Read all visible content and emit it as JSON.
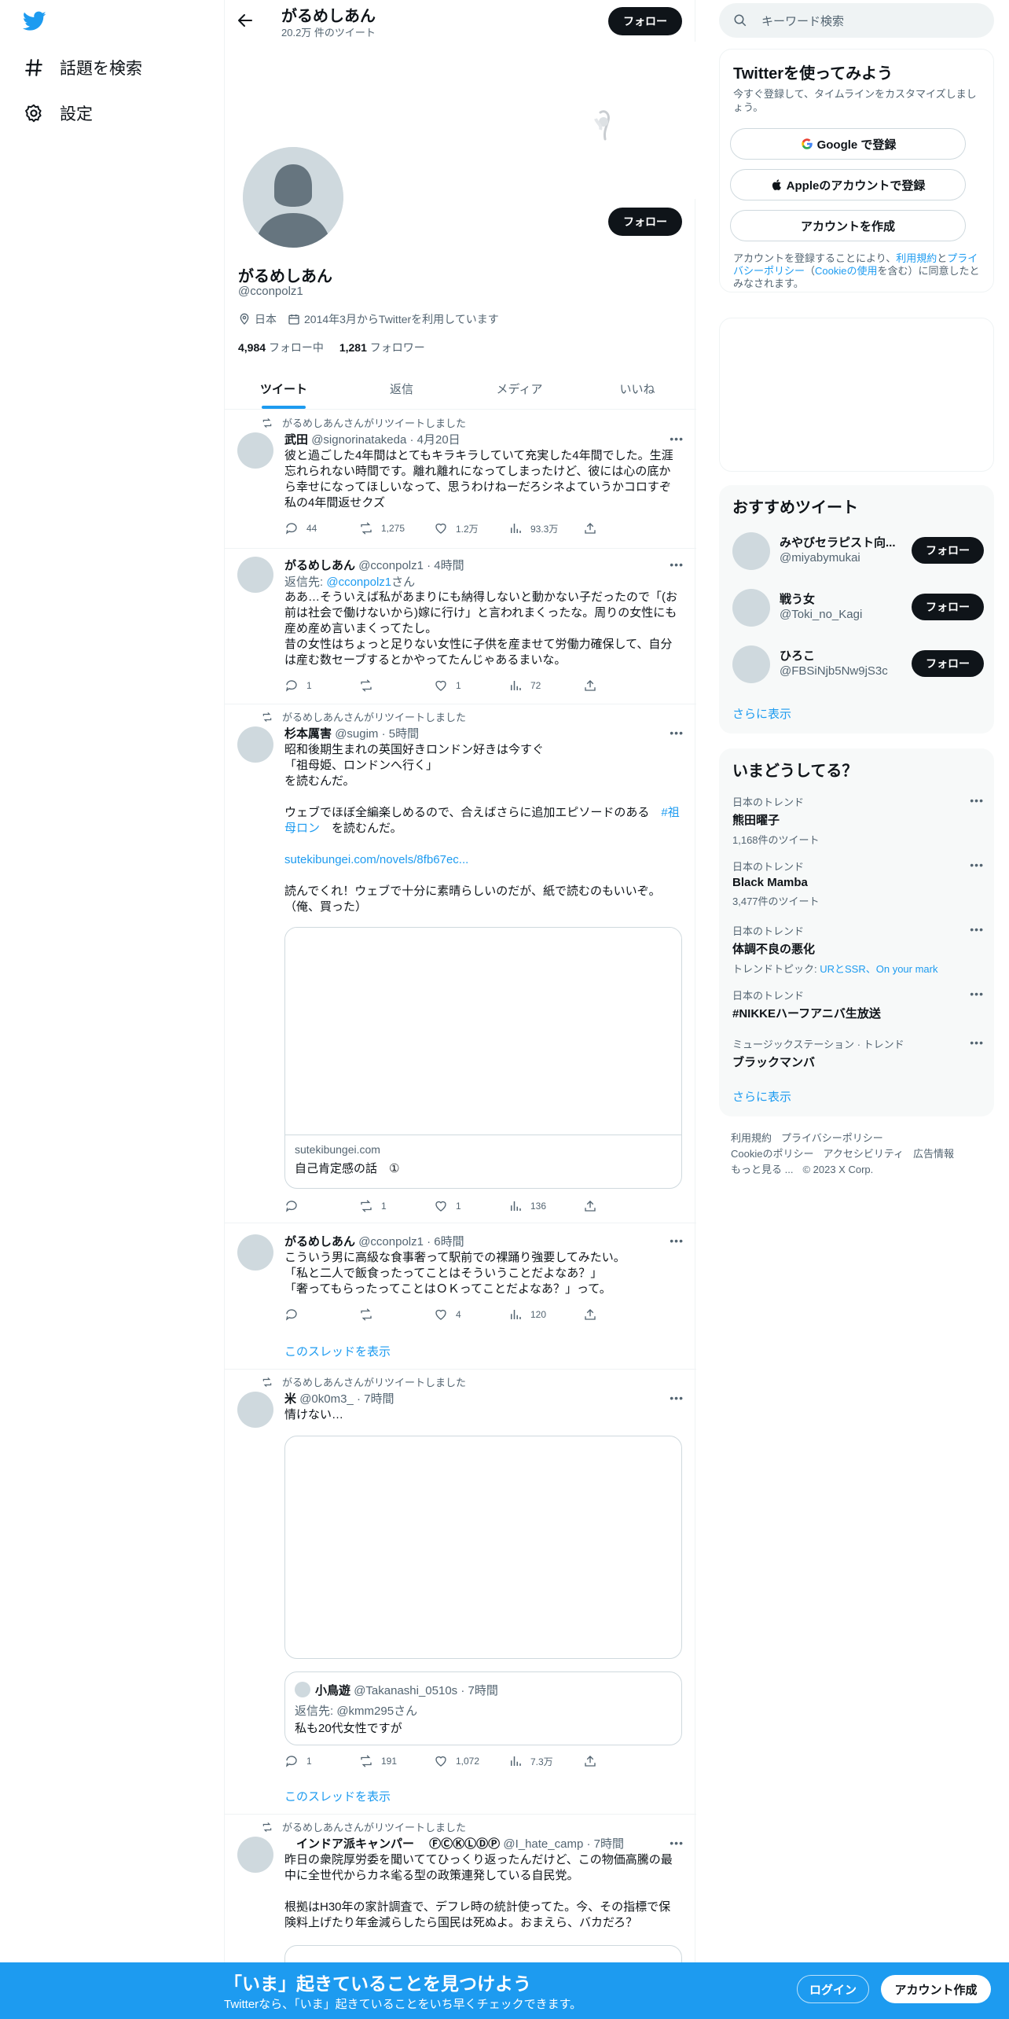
{
  "nav": {
    "items": [
      {
        "label": "話題を検索",
        "icon": "hashtag-icon"
      },
      {
        "label": "設定",
        "icon": "gear-icon"
      }
    ]
  },
  "header": {
    "name": "がるめしあん",
    "tweet_count": "20.2万 件のツイート",
    "follow_label": "フォロー"
  },
  "profile": {
    "name": "がるめしあん",
    "handle": "@cconpolz1",
    "location": "日本",
    "joined": "2014年3月からTwitterを利用しています",
    "following_count": "4,984",
    "following_label": "フォロー中",
    "followers_count": "1,281",
    "followers_label": "フォロワー",
    "follow_label": "フォロー"
  },
  "tabs": [
    "ツイート",
    "返信",
    "メディア",
    "いいね"
  ],
  "tweets": [
    {
      "retweet_label": "がるめしあんさんがリツイートしました",
      "name": "武田",
      "meta": "@signorinatakeda · 4月20日",
      "body": "彼と過ごした4年間はとてもキラキラしていて充実した4年間でした。生涯忘れられない時間です。離れ離れになってしまったけど、彼には心の底から幸せになってほしいなって、思うわけねーだろシネよていうかコロすぞ私の4年間返せクズ",
      "replies": "44",
      "retweets": "1,275",
      "likes": "1.2万",
      "views": "93.3万"
    },
    {
      "name": "がるめしあん",
      "meta": "@cconpolz1 · 4時間",
      "reply_prefix": "返信先: ",
      "reply_to": "@cconpolz1",
      "reply_suffix": "さん",
      "body": "ああ…そういえば私があまりにも納得しないと動かない子だったので「(お前は社会で働けないから)嫁に行け」と言われまくったな。周りの女性にも産め産め言いまくってたし。\n昔の女性はちょっと足りない女性に子供を産ませて労働力確保して、自分は産む数セーブするとかやってたんじゃあるまいな。",
      "replies": "1",
      "retweets": "",
      "likes": "1",
      "views": "72"
    },
    {
      "retweet_label": "がるめしあんさんがリツイートしました",
      "name": "杉本厲害",
      "meta": "@sugim · 5時間",
      "body_1": "昭和後期生まれの英国好きロンドン好きは今すぐ\n「祖母姫、ロンドンへ行く」\nを読むんだ。\n\nウェブでほぼ全編楽しめるので、合えばさらに追加エピソードのある",
      "hashtag": "#祖母ロン",
      "body_2": "を読むんだ。",
      "url": "sutekibungei.com/novels/8fb67ec...",
      "body_3": "読んでくれ！ウェブで十分に素晴らしいのだが、紙で読むのもいいぞ。（俺、買った）",
      "card_domain": "sutekibungei.com",
      "card_title": "自己肯定感の話　①",
      "replies": "",
      "retweets": "1",
      "likes": "1",
      "views": "136"
    },
    {
      "name": "がるめしあん",
      "meta": "@cconpolz1 · 6時間",
      "body": "こういう男に高級な食事奢って駅前での裸踊り強要してみたい。\n「私と二人で飯食ったってことはそういうことだよなあ？」\n「奢ってもらったってことはＯＫってことだよなあ？」って。",
      "replies": "",
      "retweets": "",
      "likes": "4",
      "views": "120",
      "thread_label": "このスレッドを表示"
    },
    {
      "retweet_label": "がるめしあんさんがリツイートしました",
      "name": "米",
      "meta": "@0k0m3_ · 7時間",
      "body": "情けない…",
      "quote_name": "小鳥遊",
      "quote_meta": "@Takanashi_0510s · 7時間",
      "quote_reply": "返信先: @kmm295さん",
      "quote_body": "私も20代女性ですが",
      "replies": "1",
      "retweets": "191",
      "likes": "1,072",
      "views": "7.3万",
      "thread_label": "このスレッドを表示"
    },
    {
      "retweet_label": "がるめしあんさんがリツイートしました",
      "name": "　インドア派キャンパー　 ⒻⒸⓀⓁⒹⓅ",
      "meta": "@I_hate_camp · 7時間",
      "body": "昨日の衆院厚労委を聞いててひっくり返ったんだけど、この物価高騰の最中に全世代からカネ毟る型の政策連発している自民党。\n\n根拠はH30年の家計調査で、デフレ時の統計使ってた。今、その指標で保険料上げたり年金減らしたら国民は死ぬよ。おまえら、バカだろ？"
    }
  ],
  "search": {
    "placeholder": "キーワード検索"
  },
  "signup": {
    "title": "Twitterを使ってみよう",
    "subtitle": "今すぐ登録して、タイムラインをカスタマイズしましょう。",
    "google_label": "Google で登録",
    "apple_label": "Appleのアカウントで登録",
    "create_label": "アカウントを作成",
    "legal_1": "アカウントを登録することにより、",
    "legal_link_1": "利用規約",
    "legal_2": "と",
    "legal_link_2": "プライバシーポリシー",
    "legal_3": "（",
    "legal_link_3": "Cookieの使用",
    "legal_4": "を含む）に同意したとみなされます。"
  },
  "recommend": {
    "title": "おすすめツイート",
    "users": [
      {
        "name": "みやびセラピスト向...",
        "handle": "@miyabymukai"
      },
      {
        "name": "戦う女",
        "handle": "@Toki_no_Kagi"
      },
      {
        "name": "ひろこ",
        "handle": "@FBSiNjb5Nw9jS3c"
      }
    ],
    "follow_label": "フォロー",
    "more_label": "さらに表示"
  },
  "trends": {
    "title": "いまどうしてる？",
    "items": [
      {
        "category": "日本のトレンド",
        "name": "熊田曜子",
        "count": "1,168件のツイート"
      },
      {
        "category": "日本のトレンド",
        "name": "Black Mamba",
        "count": "3,477件のツイート"
      },
      {
        "category": "日本のトレンド",
        "name": "体調不良の悪化",
        "count_prefix": "トレンドトピック: ",
        "count_links": "URとSSR、On your mark"
      },
      {
        "category": "日本のトレンド",
        "name": "#NIKKEハーフアニバ生放送"
      },
      {
        "category": "ミュージックステーション · トレンド",
        "name": "ブラックマンバ"
      }
    ],
    "more_label": "さらに表示"
  },
  "footer": {
    "links": [
      "利用規約",
      "プライバシーポリシー",
      "Cookieのポリシー",
      "アクセシビリティ",
      "広告情報",
      "もっと見る ..."
    ],
    "copyright": "© 2023 X Corp."
  },
  "bottom_bar": {
    "title": "「いま」起きていることを見つけよう",
    "subtitle": "Twitterなら、「いま」起きていることをいち早くチェックできます。",
    "login_label": "ログイン",
    "create_label": "アカウント作成"
  },
  "colors": {
    "accent": "#1d9bf0",
    "text": "#0f1419",
    "secondary": "#536471",
    "border": "#eff3f4"
  }
}
